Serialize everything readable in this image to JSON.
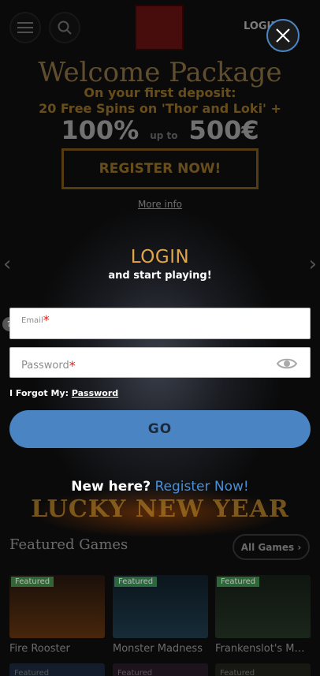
{
  "header": {
    "login_label": "LOGIN"
  },
  "promo": {
    "title": "Welcome Package",
    "line1": "On your first deposit:",
    "line2": "20 Free Spins on 'Thor and Loki' +",
    "pct": "100%",
    "upto": "up to",
    "amount": "500€",
    "register": "REGISTER NOW!",
    "more_info": "More info"
  },
  "login": {
    "title": "LOGIN",
    "subtitle": "and start playing!",
    "email_label": "Email",
    "password_label": "Password",
    "required_mark": "*",
    "forgot_prefix": "I Forgot My:",
    "forgot_link": "Password",
    "go": "GO",
    "new_here": "New here?",
    "register_now": "Register Now!"
  },
  "banner": {
    "text": "LUCKY NEW YEAR"
  },
  "featured": {
    "title": "Featured Games",
    "all_games": "All Games",
    "badge": "Featured",
    "games": [
      {
        "name": "Fire Rooster"
      },
      {
        "name": "Monster Madness"
      },
      {
        "name": "Frankenslot's Monster"
      }
    ]
  }
}
